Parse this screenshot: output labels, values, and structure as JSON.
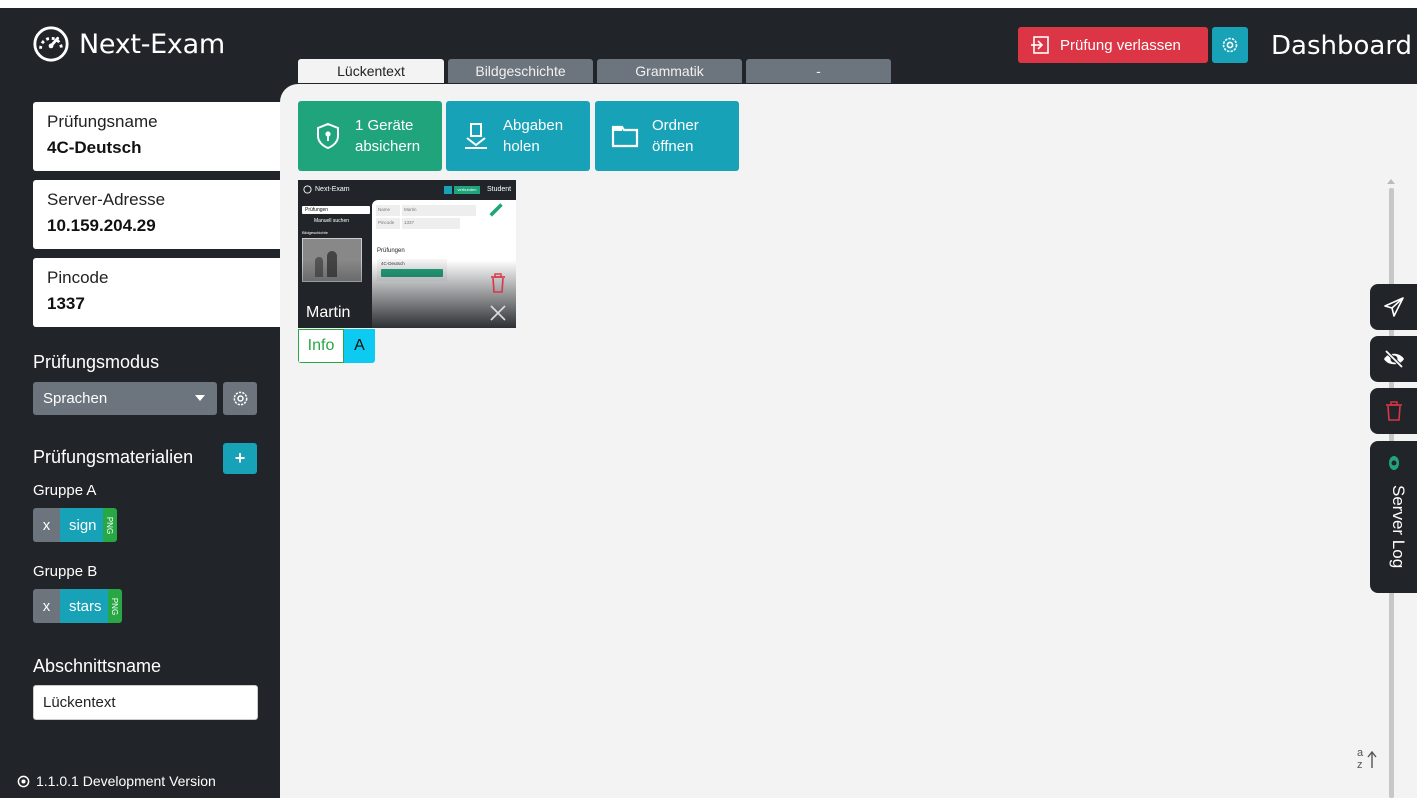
{
  "app": {
    "name": "Next-Exam",
    "title": "Dashboard",
    "leave_label": "Prüfung verlassen",
    "version": "1.1.0.1 Development Version"
  },
  "tabs": [
    {
      "label": "Lückentext",
      "active": true
    },
    {
      "label": "Bildgeschichte",
      "active": false
    },
    {
      "label": "Grammatik",
      "active": false
    },
    {
      "label": "-",
      "active": false
    }
  ],
  "sidebar": {
    "exam_name_label": "Prüfungsname",
    "exam_name_value": "4C-Deutsch",
    "server_label": "Server-Adresse",
    "server_value": "10.159.204.29",
    "pincode_label": "Pincode",
    "pincode_value": "1337",
    "mode_heading": "Prüfungsmodus",
    "mode_selected": "Sprachen",
    "materials_heading": "Prüfungsmaterialien",
    "add_label": "+",
    "groups": [
      {
        "label": "Gruppe A",
        "file": {
          "remove": "x",
          "name": "sign",
          "type": "PNG"
        }
      },
      {
        "label": "Gruppe B",
        "file": {
          "remove": "x",
          "name": "stars",
          "type": "PNG"
        }
      }
    ],
    "section_heading": "Abschnittsname",
    "section_value": "Lückentext"
  },
  "actions": {
    "secure": "1 Geräte absichern",
    "secure_line1": "1 Geräte",
    "secure_line2": "absichern",
    "fetch_line1": "Abgaben",
    "fetch_line2": "holen",
    "folder_line1": "Ordner",
    "folder_line2": "öffnen"
  },
  "student": {
    "name": "Martin",
    "info_label": "Info",
    "group_label": "A",
    "preview": {
      "app_name": "Next-Exam",
      "role": "Student",
      "connected": "verbunden",
      "menu_exams": "Prüfungen",
      "menu_search": "Manuell suchen",
      "menu_story": "Bildgeschichte",
      "field_name_label": "Name",
      "field_name_value": "Martin",
      "field_pin_label": "Pincode",
      "field_pin_value": "1337",
      "exams_heading": "Prüfungen",
      "exam_entry": "4C-Deutsch"
    }
  },
  "right_panel": {
    "server_log_label": "Server Log"
  },
  "colors": {
    "background_dark": "#212529",
    "content_bg": "#f3f3f3",
    "danger": "#dc3545",
    "info": "#17a2b8",
    "success": "#20a47c",
    "secondary": "#6c757d"
  }
}
